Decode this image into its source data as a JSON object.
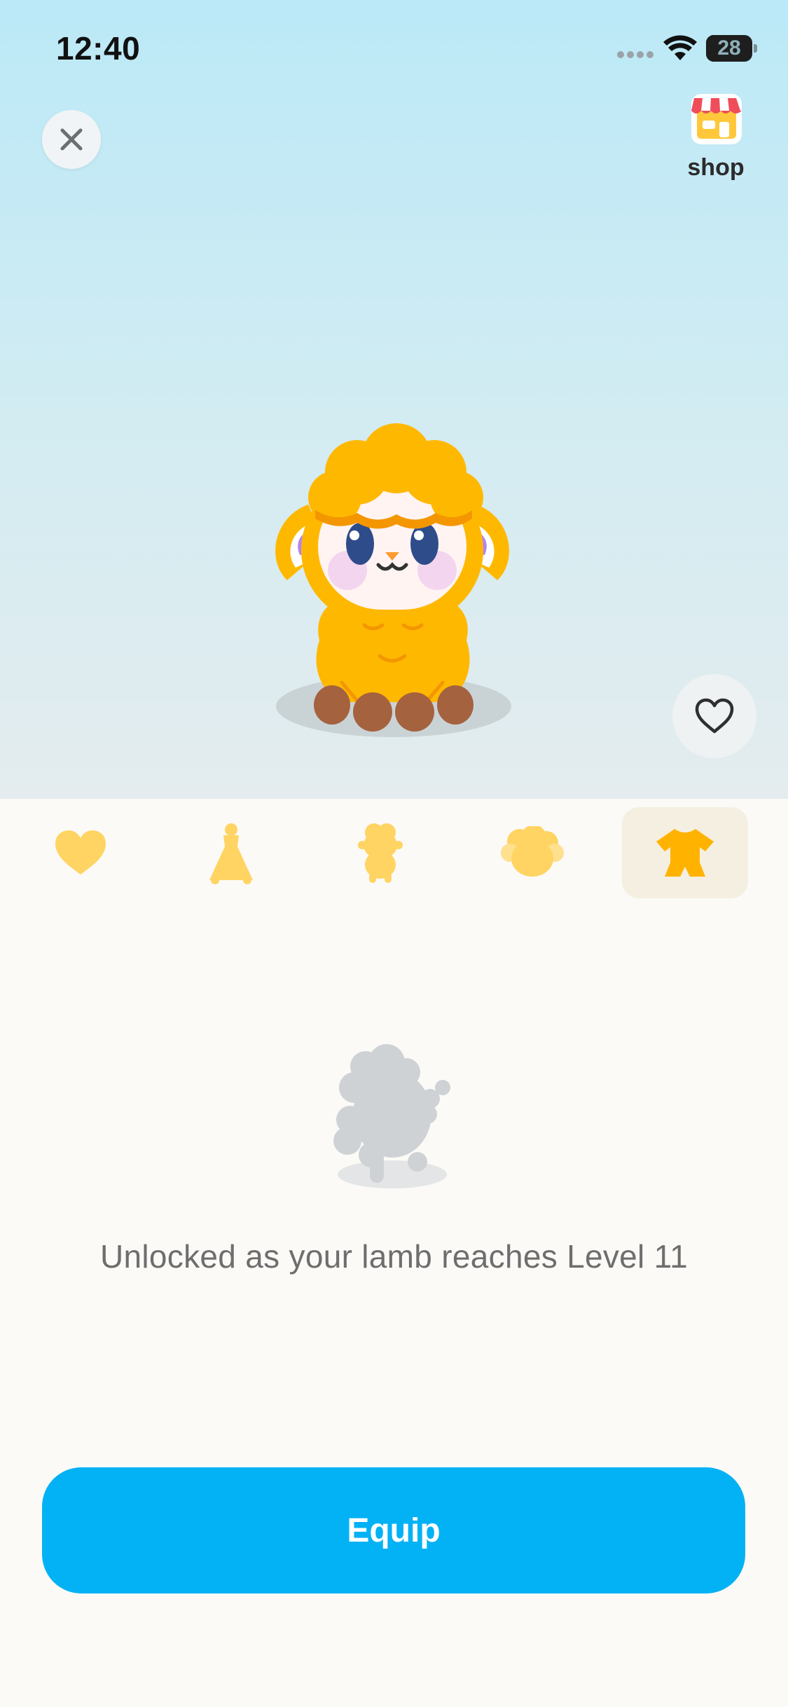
{
  "status_bar": {
    "time": "12:40",
    "battery_level": "28",
    "battery_fraction": 0.28,
    "icons": [
      "signal-icon",
      "wifi-icon",
      "battery-icon"
    ]
  },
  "header": {
    "close_icon": "close-icon",
    "shop_icon": "shop-storefront-icon",
    "shop_label": "shop"
  },
  "preview": {
    "character": "lamb",
    "favorite_icon": "heart-outline-icon"
  },
  "tabs": [
    {
      "icon": "heart-icon",
      "selected": false
    },
    {
      "icon": "dress-icon",
      "selected": false
    },
    {
      "icon": "lamb-body-icon",
      "selected": false
    },
    {
      "icon": "wool-hair-icon",
      "selected": false
    },
    {
      "icon": "romper-icon",
      "selected": true
    }
  ],
  "content": {
    "locked_item_icon": "locked-lamb-silhouette-icon",
    "unlock_message": "Unlocked as your lamb reaches Level 11"
  },
  "actions": {
    "equip_label": "Equip"
  },
  "colors": {
    "accent": "#03B2F4",
    "lamb_wool": "#FFB800",
    "tab_icon_inactive": "#FFD462",
    "tab_icon_active": "#FFB300",
    "tab_selected_bg": "#F5EFE1",
    "locked_gray": "#CFD2D5"
  }
}
